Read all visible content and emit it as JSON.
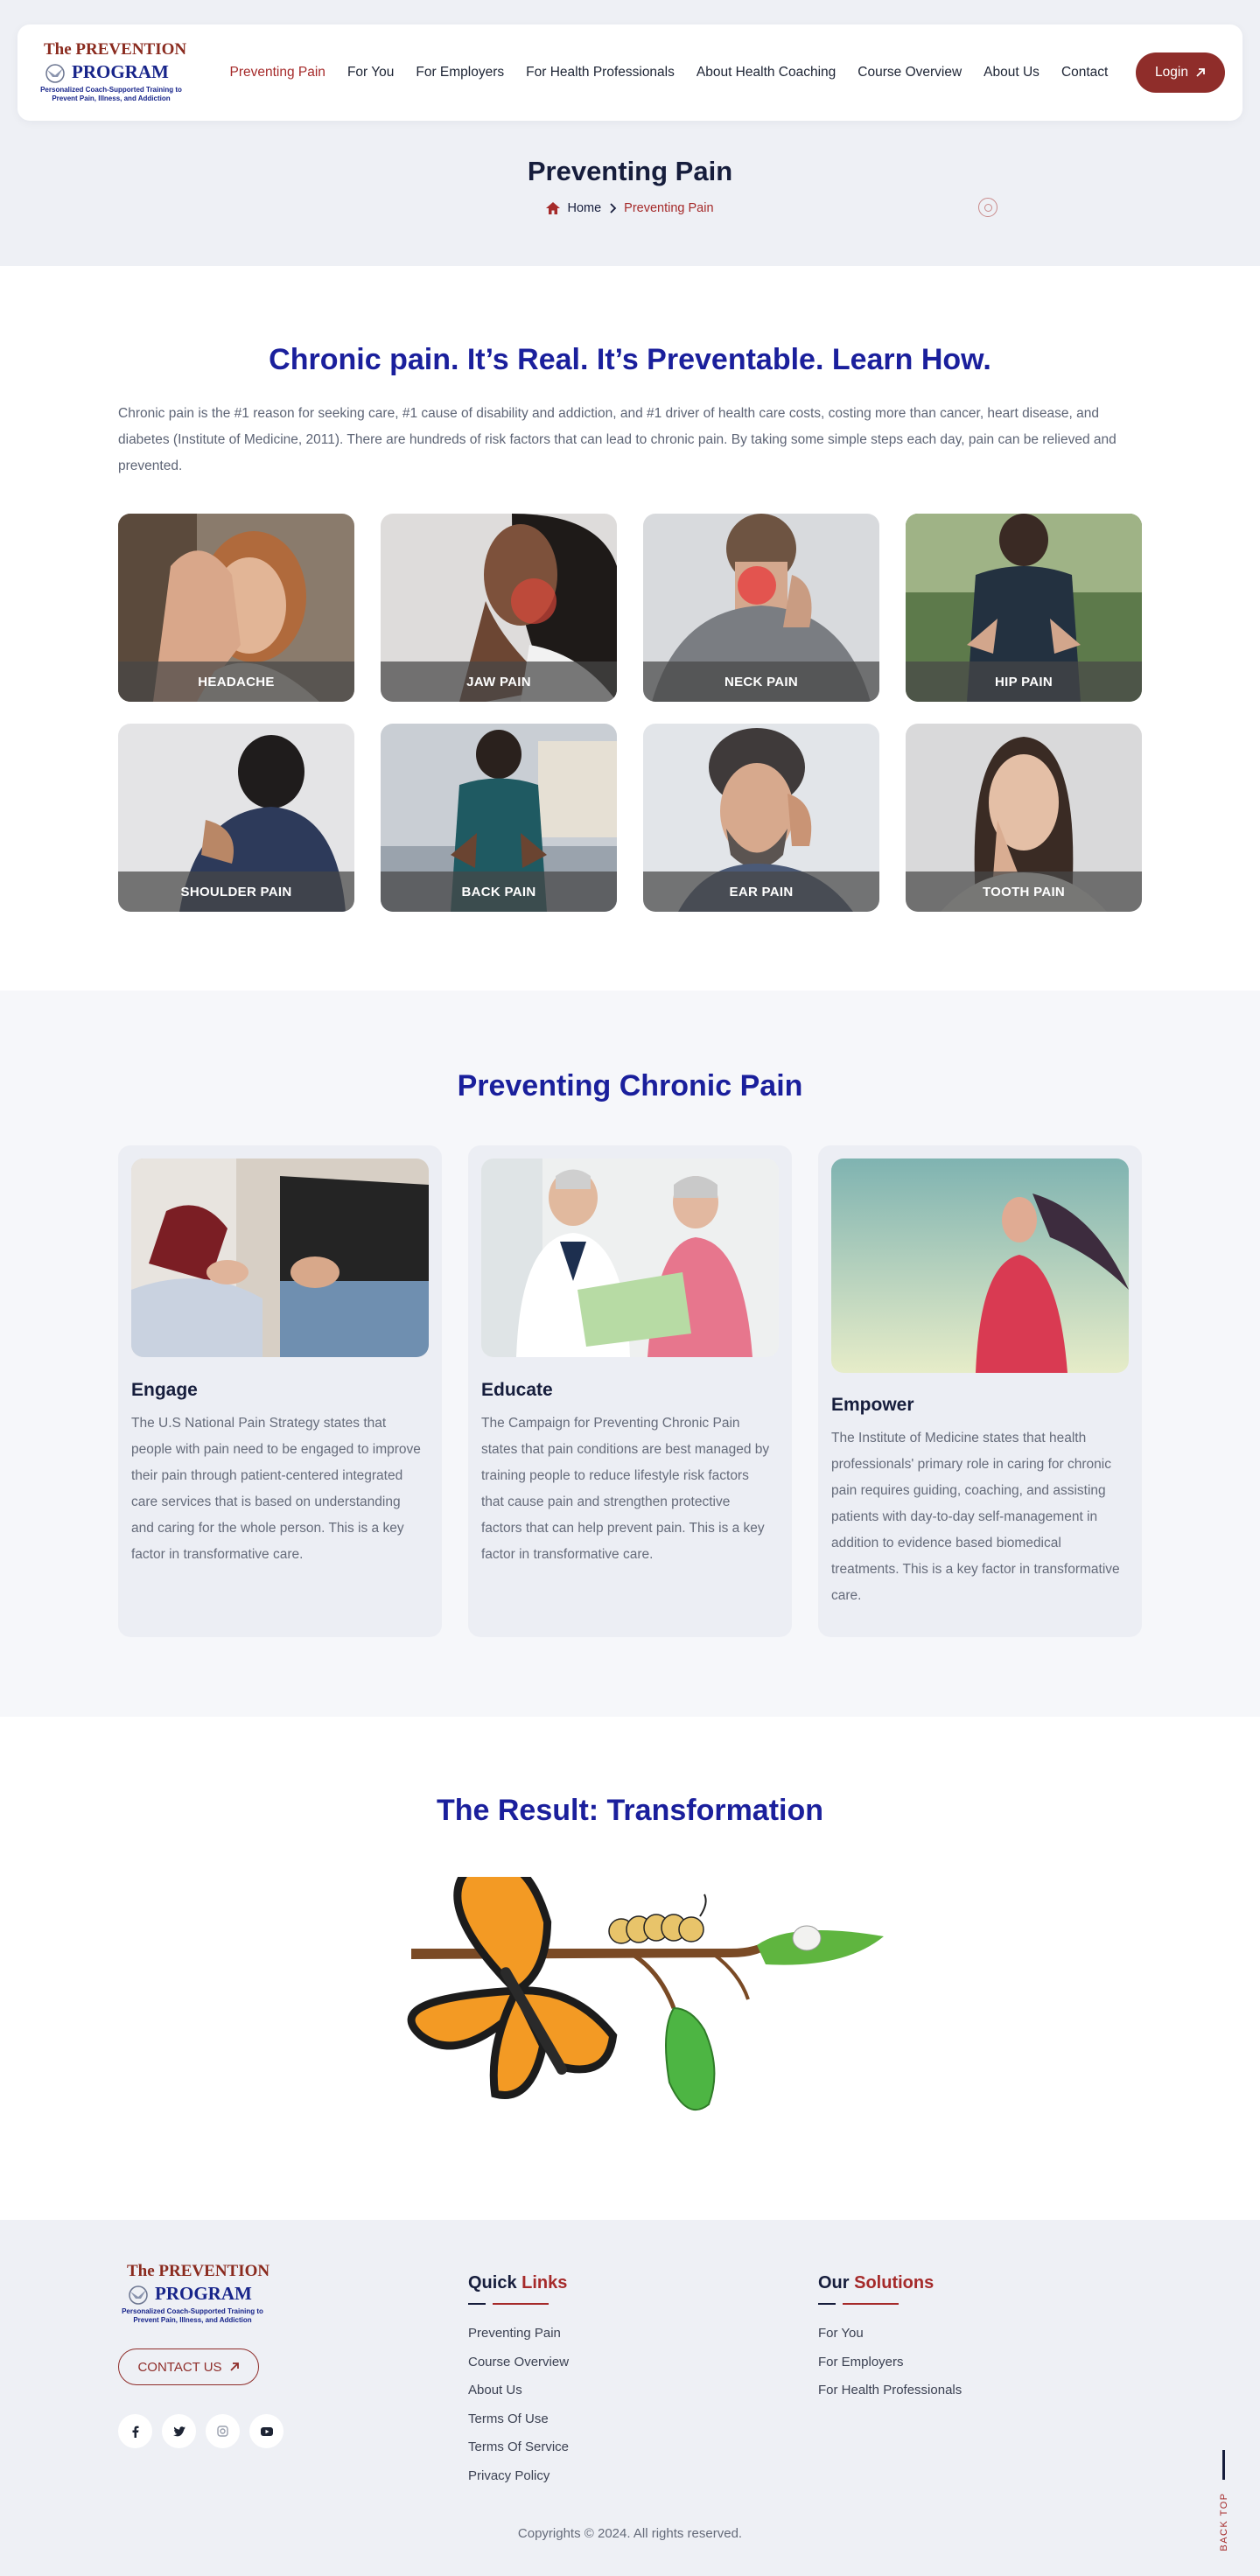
{
  "logo": {
    "line1": "The PREVENTION",
    "line2": "PROGRAM",
    "tagline": "Personalized Coach-Supported Training to Prevent Pain, Illness, and Addiction"
  },
  "nav": {
    "items": [
      {
        "label": "Preventing Pain",
        "active": true
      },
      {
        "label": "For You",
        "active": false
      },
      {
        "label": "For Employers",
        "active": false
      },
      {
        "label": "For Health Professionals",
        "active": false
      },
      {
        "label": "About Health Coaching",
        "active": false
      },
      {
        "label": "Course Overview",
        "active": false
      },
      {
        "label": "About Us",
        "active": false
      },
      {
        "label": "Contact",
        "active": false
      }
    ],
    "login_label": "Login"
  },
  "hero": {
    "title": "Preventing Pain",
    "breadcrumb": {
      "home": "Home",
      "current": "Preventing Pain"
    }
  },
  "intro": {
    "heading": "Chronic pain. It’s Real. It’s Preventable. Learn How.",
    "text": "Chronic pain is the #1 reason for seeking care, #1 cause of disability and addiction, and #1 driver of health care costs, costing more than cancer, heart disease, and diabetes (Institute of Medicine, 2011). There are hundreds of risk factors that can lead to chronic pain. By taking some simple steps each day, pain can be relieved and prevented."
  },
  "pain_cards": [
    {
      "label": "HEADACHE"
    },
    {
      "label": "JAW PAIN"
    },
    {
      "label": "NECK PAIN"
    },
    {
      "label": "HIP PAIN"
    },
    {
      "label": "SHOULDER PAIN"
    },
    {
      "label": "BACK PAIN"
    },
    {
      "label": "EAR PAIN"
    },
    {
      "label": "TOOTH PAIN"
    }
  ],
  "chronic": {
    "heading": "Preventing Chronic Pain",
    "pillars": [
      {
        "title": "Engage",
        "text": "The U.S National Pain Strategy states that people with pain need to be engaged to improve their pain through patient-centered integrated care services that is based on understanding and caring for the whole person. This is a key factor in transformative care."
      },
      {
        "title": "Educate",
        "text": "The Campaign for Preventing Chronic Pain states that pain conditions are best managed by training people to reduce lifestyle risk factors that cause pain and strengthen protective factors that can help prevent pain. This is a key factor in transformative care."
      },
      {
        "title": "Empower",
        "text": "The Institute of Medicine states that health professionals' primary role in caring for chronic pain requires guiding, coaching, and assisting patients with day-to-day self-management in addition to evidence based biomedical treatments. This is a key factor in transformative care."
      }
    ]
  },
  "result": {
    "heading": "The Result: Transformation"
  },
  "footer": {
    "contact_label": "CONTACT US",
    "socials": [
      "facebook-icon",
      "twitter-icon",
      "instagram-icon",
      "youtube-icon"
    ],
    "quick_links": {
      "title_a": "Quick",
      "title_b": "Links",
      "items": [
        "Preventing Pain",
        "Course Overview",
        "About Us",
        "Terms Of Use",
        "Terms Of Service",
        "Privacy Policy"
      ]
    },
    "solutions": {
      "title_a": "Our",
      "title_b": "Solutions",
      "items": [
        "For You",
        "For Employers",
        "For Health Professionals"
      ]
    },
    "copyright": "Copyrights © 2024. All rights reserved.",
    "back_top": "BACK TOP"
  },
  "colors": {
    "brand_red": "#8f2d2a",
    "heading_blue": "#1a1f9c",
    "dark_navy": "#161d3c"
  }
}
